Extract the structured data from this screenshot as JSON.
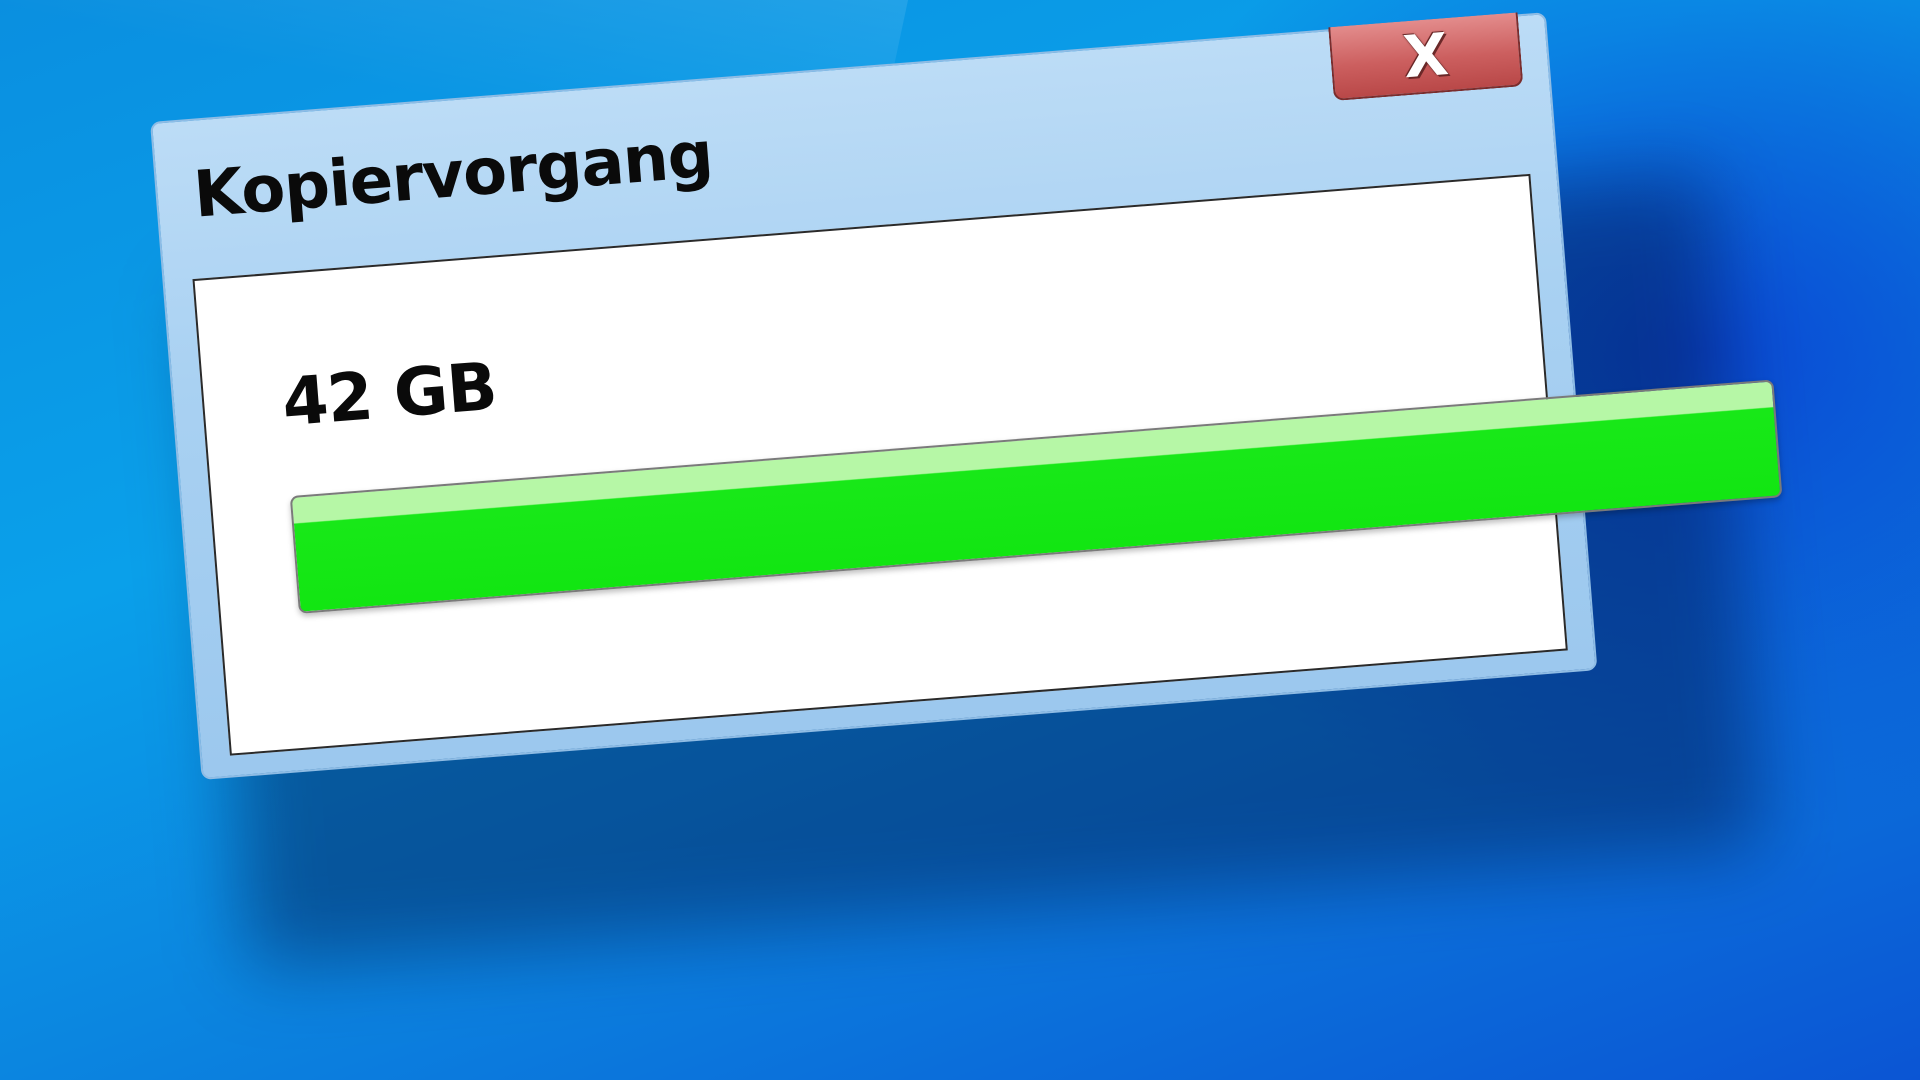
{
  "dialog": {
    "title": "Kopiervorgang",
    "close_label": "X",
    "close_icon": "close-icon",
    "size_text": "42 GB",
    "progress_fraction": 1.2
  },
  "colors": {
    "desktop": "#0a8fe0",
    "dialog_frame": "#a9d1f2",
    "close_button": "#cc5f5f",
    "progress": "#12e612"
  }
}
